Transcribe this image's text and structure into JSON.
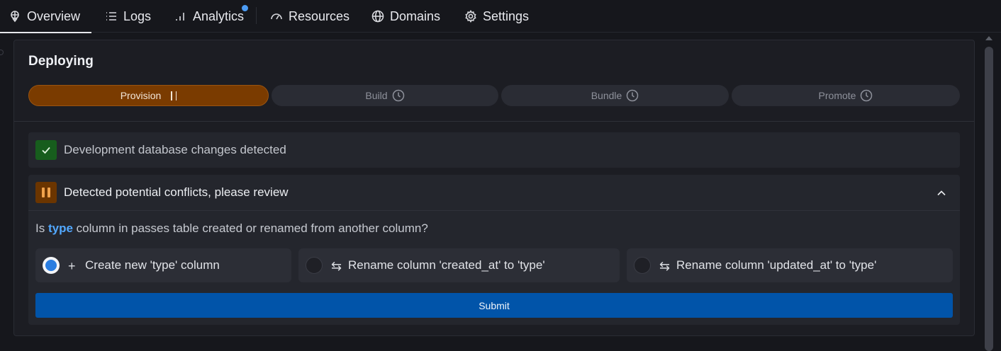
{
  "nav": {
    "tabs": [
      {
        "label": "Overview",
        "icon": "network-icon",
        "active": true
      },
      {
        "label": "Logs",
        "icon": "list-icon"
      },
      {
        "label": "Analytics",
        "icon": "bar-chart-icon",
        "notification": true
      },
      {
        "label": "Resources",
        "icon": "gauge-icon"
      },
      {
        "label": "Domains",
        "icon": "globe-icon"
      },
      {
        "label": "Settings",
        "icon": "gear-icon"
      }
    ]
  },
  "card": {
    "title": "Deploying",
    "steps": [
      {
        "label": "Provision",
        "icon": "pause-icon",
        "status": "active"
      },
      {
        "label": "Build",
        "icon": "clock-icon",
        "status": "pending"
      },
      {
        "label": "Bundle",
        "icon": "clock-icon",
        "status": "pending"
      },
      {
        "label": "Promote",
        "icon": "clock-icon",
        "status": "pending"
      }
    ],
    "success_row": {
      "text": "Development database changes detected",
      "icon": "check-icon"
    },
    "conflicts": {
      "heading": "Detected potential conflicts, please review",
      "question": {
        "prefix": "Is",
        "highlight": "type",
        "suffix": "column in passes table created or renamed from another column?"
      },
      "options": [
        {
          "icon": "+",
          "label": "Create new 'type' column",
          "selected": true
        },
        {
          "icon": "⇆",
          "label": "Rename column 'created_at' to 'type'",
          "selected": false
        },
        {
          "icon": "⇆",
          "label": "Rename column 'updated_at' to 'type'",
          "selected": false
        }
      ],
      "submit_label": "Submit"
    }
  },
  "colors": {
    "active_step": "#7a3b00",
    "submit": "#0154a9",
    "success": "#175d1d",
    "highlight": "#52a8ff"
  }
}
